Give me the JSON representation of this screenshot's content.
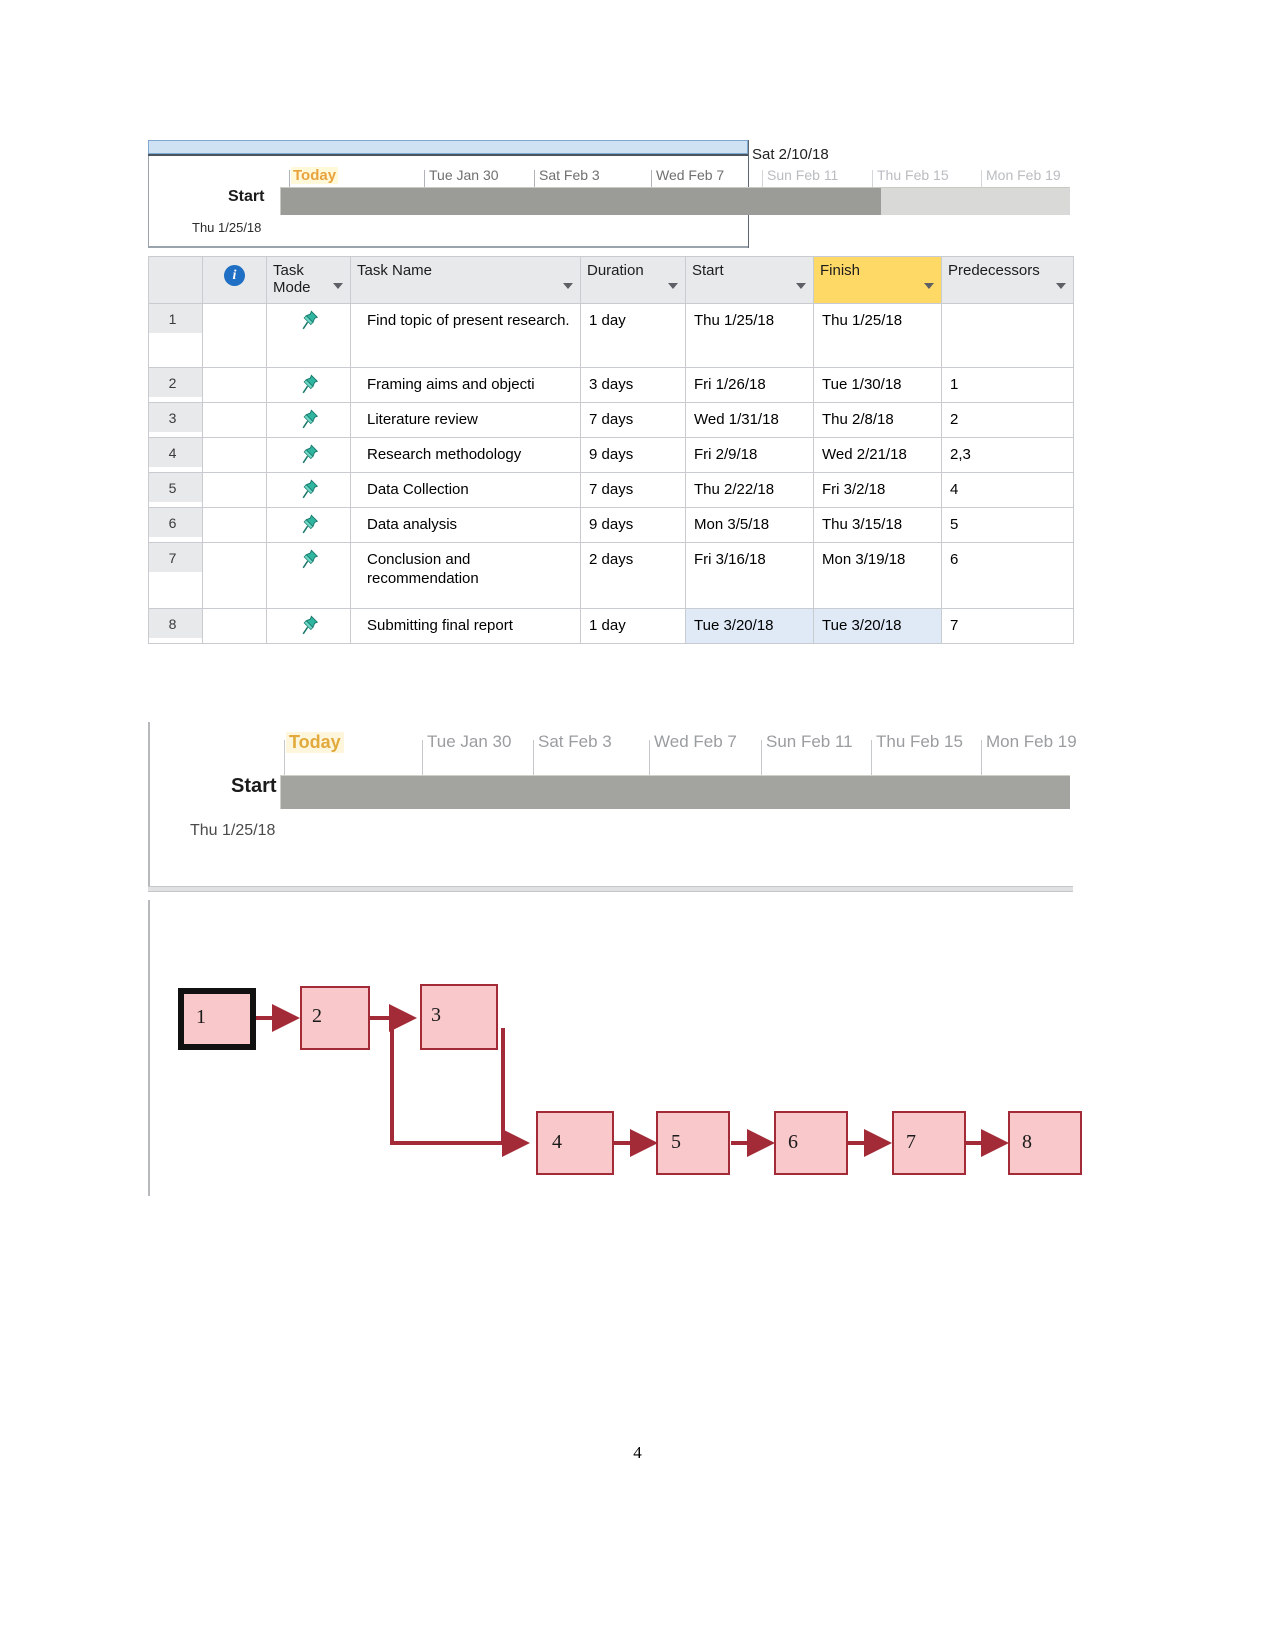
{
  "document": {
    "page_number": "4"
  },
  "timeline_top": {
    "today_label": "Today",
    "start_label": "Start",
    "start_date": "Thu 1/25/18",
    "milestone_label": "Sat 2/10/18",
    "ticks": [
      {
        "label": "Tue Jan 30",
        "dim": false
      },
      {
        "label": "Sat Feb 3",
        "dim": false
      },
      {
        "label": "Wed Feb 7",
        "dim": false
      },
      {
        "label": "Sun Feb 11",
        "dim": true
      },
      {
        "label": "Thu Feb 15",
        "dim": true
      },
      {
        "label": "Mon Feb 19",
        "dim": true
      }
    ]
  },
  "timeline_bottom": {
    "today_label": "Today",
    "start_label": "Start",
    "start_date": "Thu 1/25/18",
    "ticks": [
      {
        "label": "Tue Jan 30"
      },
      {
        "label": "Sat Feb 3"
      },
      {
        "label": "Wed Feb 7"
      },
      {
        "label": "Sun Feb 11"
      },
      {
        "label": "Thu Feb 15"
      },
      {
        "label": "Mon Feb 19"
      }
    ]
  },
  "table": {
    "columns": [
      {
        "key": "id",
        "label": "",
        "sortable": false
      },
      {
        "key": "indicators",
        "label": "",
        "sortable": false,
        "icon": "info-icon"
      },
      {
        "key": "task_mode",
        "label": "Task Mode",
        "sortable": true
      },
      {
        "key": "task_name",
        "label": "Task Name",
        "sortable": true
      },
      {
        "key": "duration",
        "label": "Duration",
        "sortable": true
      },
      {
        "key": "start",
        "label": "Start",
        "sortable": true
      },
      {
        "key": "finish",
        "label": "Finish",
        "sortable": true,
        "highlight": "#ffd966"
      },
      {
        "key": "predecessors",
        "label": "Predecessors",
        "sortable": true
      }
    ],
    "rows": [
      {
        "id": "1",
        "task_mode_icon": "pin-icon",
        "task_name": "Find topic of present research.",
        "duration": "1 day",
        "start": "Thu 1/25/18",
        "finish": "Thu 1/25/18",
        "predecessors": ""
      },
      {
        "id": "2",
        "task_mode_icon": "pin-icon",
        "task_name": "Framing aims and objecti",
        "duration": "3 days",
        "start": "Fri 1/26/18",
        "finish": "Tue 1/30/18",
        "predecessors": "1"
      },
      {
        "id": "3",
        "task_mode_icon": "pin-icon",
        "task_name": "Literature review",
        "duration": "7 days",
        "start": "Wed 1/31/18",
        "finish": "Thu 2/8/18",
        "predecessors": "2"
      },
      {
        "id": "4",
        "task_mode_icon": "pin-icon",
        "task_name": "Research methodology",
        "duration": "9 days",
        "start": "Fri 2/9/18",
        "finish": "Wed 2/21/18",
        "predecessors": "2,3"
      },
      {
        "id": "5",
        "task_mode_icon": "pin-icon",
        "task_name": "Data Collection",
        "duration": "7 days",
        "start": "Thu 2/22/18",
        "finish": "Fri 3/2/18",
        "predecessors": "4"
      },
      {
        "id": "6",
        "task_mode_icon": "pin-icon",
        "task_name": "Data analysis",
        "duration": "9 days",
        "start": "Mon 3/5/18",
        "finish": "Thu 3/15/18",
        "predecessors": "5"
      },
      {
        "id": "7",
        "task_mode_icon": "pin-icon",
        "task_name": "Conclusion and recommendation",
        "duration": "2 days",
        "start": "Fri 3/16/18",
        "finish": "Mon 3/19/18",
        "predecessors": "6"
      },
      {
        "id": "8",
        "task_mode_icon": "pin-icon",
        "task_name": "Submitting final report",
        "duration": "1 day",
        "start": "Tue 3/20/18",
        "finish": "Tue 3/20/18",
        "predecessors": "7"
      }
    ]
  },
  "network_diagram": {
    "node_fill": "#f9c8cb",
    "node_border": "#a32b38",
    "critical_border": "#111111",
    "connector_color": "#a32b38",
    "nodes": [
      {
        "id": "1",
        "label": "1",
        "critical": true
      },
      {
        "id": "2",
        "label": "2",
        "critical": false
      },
      {
        "id": "3",
        "label": "3",
        "critical": false
      },
      {
        "id": "4",
        "label": "4",
        "critical": false
      },
      {
        "id": "5",
        "label": "5",
        "critical": false
      },
      {
        "id": "6",
        "label": "6",
        "critical": false
      },
      {
        "id": "7",
        "label": "7",
        "critical": false
      },
      {
        "id": "8",
        "label": "8",
        "critical": false
      }
    ],
    "edges": [
      {
        "from": "1",
        "to": "2"
      },
      {
        "from": "2",
        "to": "3"
      },
      {
        "from": "2",
        "to": "4"
      },
      {
        "from": "3",
        "to": "4"
      },
      {
        "from": "4",
        "to": "5"
      },
      {
        "from": "5",
        "to": "6"
      },
      {
        "from": "6",
        "to": "7"
      },
      {
        "from": "7",
        "to": "8"
      }
    ]
  }
}
